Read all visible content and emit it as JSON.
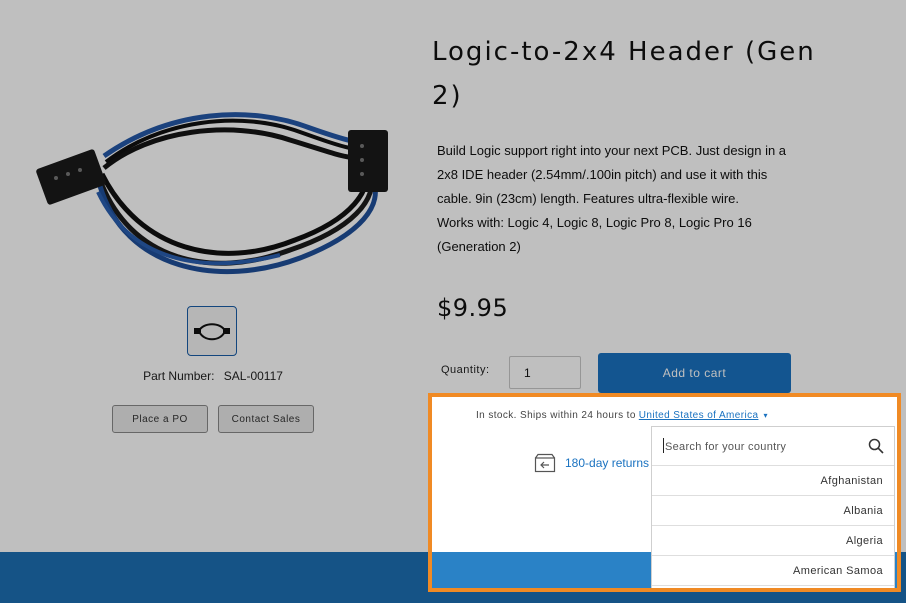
{
  "product": {
    "title": "Logic-to-2x4 Header (Gen 2)",
    "description_1": "Build Logic support right into your next PCB. Just design in a 2x8 IDE header (2.54mm/.100in pitch) and use it with this cable. 9in (23cm) length. Features ultra-flexible wire.",
    "description_2": "Works with: Logic 4, Logic 8, Logic Pro 8, Logic Pro 16 (Generation 2)",
    "price": "$9.95",
    "part_number_label": "Part Number:",
    "part_number": "SAL-00117"
  },
  "actions": {
    "place_po": "Place a PO",
    "contact_sales": "Contact Sales",
    "quantity_label": "Quantity:",
    "quantity_value": "1",
    "add_to_cart": "Add to cart"
  },
  "shipping": {
    "stock_text": "In stock. Ships within 24 hours to",
    "country": "United States of America",
    "returns_text": "180-day returns"
  },
  "country_dropdown": {
    "search_placeholder": "Search for your country",
    "options": [
      "Afghanistan",
      "Albania",
      "Algeria",
      "American Samoa"
    ]
  },
  "colors": {
    "accent": "#1a72c0",
    "highlight_border": "#f08a24",
    "footer": "#1d6fb3"
  }
}
